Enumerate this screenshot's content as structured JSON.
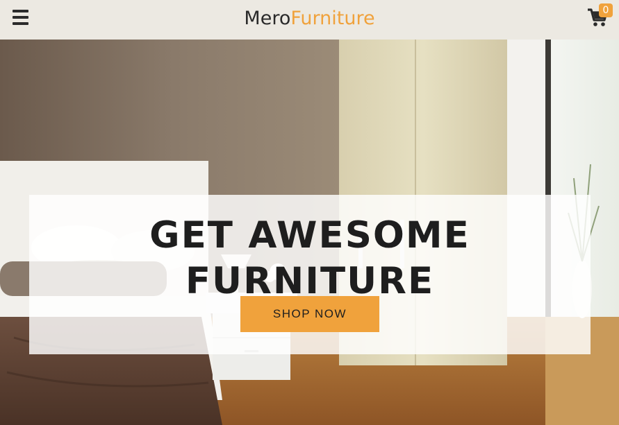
{
  "header": {
    "menu_icon": "hamburger-menu-icon",
    "logo_part1": "Mero",
    "logo_part2": "Furniture",
    "cart_icon": "shopping-cart-icon",
    "cart_count": "0"
  },
  "hero": {
    "title": "GET AWESOME FURNITURE",
    "cta_label": "SHOP NOW"
  },
  "colors": {
    "accent": "#f0a23c",
    "navbar_bg": "#ece9e2",
    "text_dark": "#1e1e1e"
  }
}
